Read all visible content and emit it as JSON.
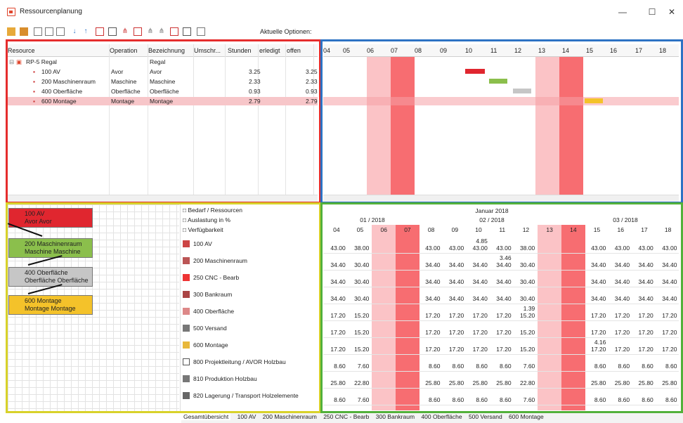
{
  "window": {
    "title": "Ressourcenplanung",
    "min": "—",
    "max": "☐",
    "close": "✕"
  },
  "toolbar": {
    "label": "Aktuelle Optionen:"
  },
  "tree": {
    "columns": [
      "Resource",
      "Operation",
      "Bezeichnung",
      "Umschr...",
      "Stunden",
      "erledigt",
      "offen"
    ],
    "rows": [
      {
        "resource": "RP-5 Regal",
        "operation": "",
        "bezeichnung": "Regal",
        "stunden": "",
        "offen": ""
      },
      {
        "resource": "100 AV",
        "operation": "Avor",
        "bezeichnung": "Avor",
        "stunden": "3.25",
        "offen": "3.25"
      },
      {
        "resource": "200 Maschinenraum",
        "operation": "Maschine",
        "bezeichnung": "Maschine",
        "stunden": "2.33",
        "offen": "2.33"
      },
      {
        "resource": "400 Oberfläche",
        "operation": "Oberfläche",
        "bezeichnung": "Oberfläche",
        "stunden": "0.93",
        "offen": "0.93"
      },
      {
        "resource": "600 Montage",
        "operation": "Montage",
        "bezeichnung": "Montage",
        "stunden": "2.79",
        "offen": "2.79"
      }
    ]
  },
  "gantt": {
    "days": [
      "04",
      "05",
      "06",
      "07",
      "08",
      "09",
      "10",
      "11",
      "12",
      "13",
      "14",
      "15",
      "16",
      "17",
      "18"
    ]
  },
  "nodes": [
    {
      "title": "100 AV",
      "sub": "Avor Avor",
      "color": "#e0262f"
    },
    {
      "title": "200 Maschinenraum",
      "sub": "Maschine Maschine",
      "color": "#8bbf4c"
    },
    {
      "title": "400 Oberfläche",
      "sub": "Oberfläche Oberfläche",
      "color": "#c6c6c6"
    },
    {
      "title": "600 Montage",
      "sub": "Montage Montage",
      "color": "#f4c22a"
    }
  ],
  "options": [
    "Bedarf / Ressourcen",
    "Auslastung in %",
    "Verfügbarkeit"
  ],
  "resources": [
    "100 AV",
    "200 Maschinenraum",
    "250 CNC - Bearb",
    "300 Bankraum",
    "400 Oberfläche",
    "500 Versand",
    "600 Montage",
    "800 Projektleitung / AVOR Holzbau",
    "810 Produktion Holzbau",
    "820 Lagerung / Transport Holzelemente"
  ],
  "calendar": {
    "month": "Januar 2018",
    "weeks": [
      "01 / 2018",
      "02 / 2018",
      "03 / 2018"
    ],
    "days": [
      "04",
      "05",
      "06",
      "07",
      "08",
      "09",
      "10",
      "11",
      "12",
      "13",
      "14",
      "15",
      "16",
      "17",
      "18"
    ],
    "rows": [
      {
        "vals": [
          "43.00",
          "38.00",
          "",
          "",
          "43.00",
          "43.00",
          "43.00",
          "43.00",
          "38.00",
          "",
          "",
          "43.00",
          "43.00",
          "43.00",
          "43.00"
        ],
        "top": {
          "10": "4.85"
        }
      },
      {
        "vals": [
          "34.40",
          "30.40",
          "",
          "",
          "34.40",
          "34.40",
          "34.40",
          "34.40",
          "30.40",
          "",
          "",
          "34.40",
          "34.40",
          "34.40",
          "34.40"
        ],
        "top": {
          "11": "3.46"
        }
      },
      {
        "vals": [
          "34.40",
          "30.40",
          "",
          "",
          "34.40",
          "34.40",
          "34.40",
          "34.40",
          "30.40",
          "",
          "",
          "34.40",
          "34.40",
          "34.40",
          "34.40"
        ],
        "top": {}
      },
      {
        "vals": [
          "34.40",
          "30.40",
          "",
          "",
          "34.40",
          "34.40",
          "34.40",
          "34.40",
          "30.40",
          "",
          "",
          "34.40",
          "34.40",
          "34.40",
          "34.40"
        ],
        "top": {}
      },
      {
        "vals": [
          "17.20",
          "15.20",
          "",
          "",
          "17.20",
          "17.20",
          "17.20",
          "17.20",
          "15.20",
          "",
          "",
          "17.20",
          "17.20",
          "17.20",
          "17.20"
        ],
        "top": {
          "12": "1.39"
        }
      },
      {
        "vals": [
          "17.20",
          "15.20",
          "",
          "",
          "17.20",
          "17.20",
          "17.20",
          "17.20",
          "15.20",
          "",
          "",
          "17.20",
          "17.20",
          "17.20",
          "17.20"
        ],
        "top": {}
      },
      {
        "vals": [
          "17.20",
          "15.20",
          "",
          "",
          "17.20",
          "17.20",
          "17.20",
          "17.20",
          "15.20",
          "",
          "",
          "17.20",
          "17.20",
          "17.20",
          "17.20"
        ],
        "top": {
          "15": "4.16"
        }
      },
      {
        "vals": [
          "8.60",
          "7.60",
          "",
          "",
          "8.60",
          "8.60",
          "8.60",
          "8.60",
          "7.60",
          "",
          "",
          "8.60",
          "8.60",
          "8.60",
          "8.60"
        ],
        "top": {}
      },
      {
        "vals": [
          "25.80",
          "22.80",
          "",
          "",
          "25.80",
          "25.80",
          "25.80",
          "25.80",
          "22.80",
          "",
          "",
          "25.80",
          "25.80",
          "25.80",
          "25.80"
        ],
        "top": {}
      },
      {
        "vals": [
          "8.60",
          "7.60",
          "",
          "",
          "8.60",
          "8.60",
          "8.60",
          "8.60",
          "7.60",
          "",
          "",
          "8.60",
          "8.60",
          "8.60",
          "8.60"
        ],
        "top": {}
      }
    ]
  },
  "tabs": [
    "Gesamtübersicht",
    "100 AV",
    "200 Maschinenraum",
    "250 CNC - Bearb",
    "300 Bankraum",
    "400 Oberfläche",
    "500 Versand",
    "600 Montage"
  ]
}
